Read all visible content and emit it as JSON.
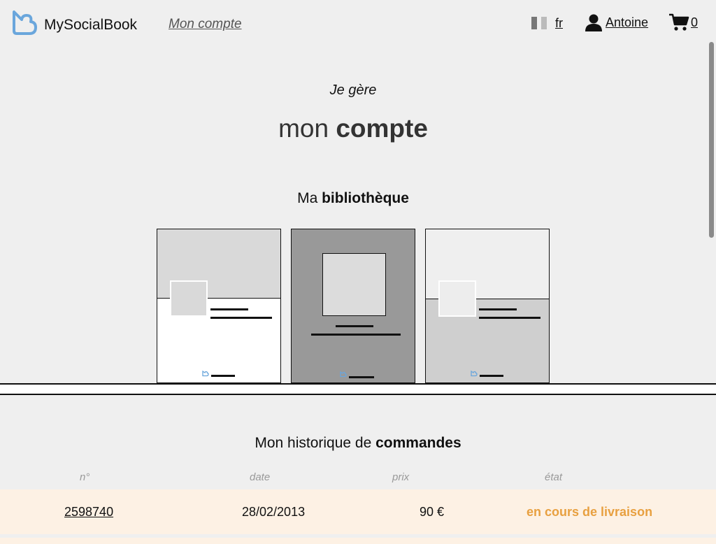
{
  "header": {
    "brand": "MySocialBook",
    "nav_link": "Mon compte",
    "language": "fr",
    "user_name": "Antoine",
    "cart_count": "0"
  },
  "hero": {
    "subtitle": "Je gère",
    "title_light": "mon ",
    "title_bold": "compte"
  },
  "library": {
    "title_light": "Ma ",
    "title_bold": "bibliothèque",
    "books": [
      "book-cover-1",
      "book-cover-2",
      "book-cover-3"
    ]
  },
  "orders": {
    "title_light": "Mon historique de ",
    "title_bold": "commandes",
    "columns": [
      "n°",
      "date",
      "prix",
      "état"
    ],
    "rows": [
      {
        "number": "2598740",
        "date": "28/02/2013",
        "price": "90 €",
        "status": "en cours de livraison"
      }
    ]
  },
  "colors": {
    "brand_blue": "#6aa6dc",
    "status_orange": "#e8a040",
    "row_bg": "#fdf1e4",
    "page_bg": "#efefef"
  },
  "icons": [
    "heart-logo-icon",
    "flag-icon",
    "user-icon",
    "cart-icon"
  ]
}
